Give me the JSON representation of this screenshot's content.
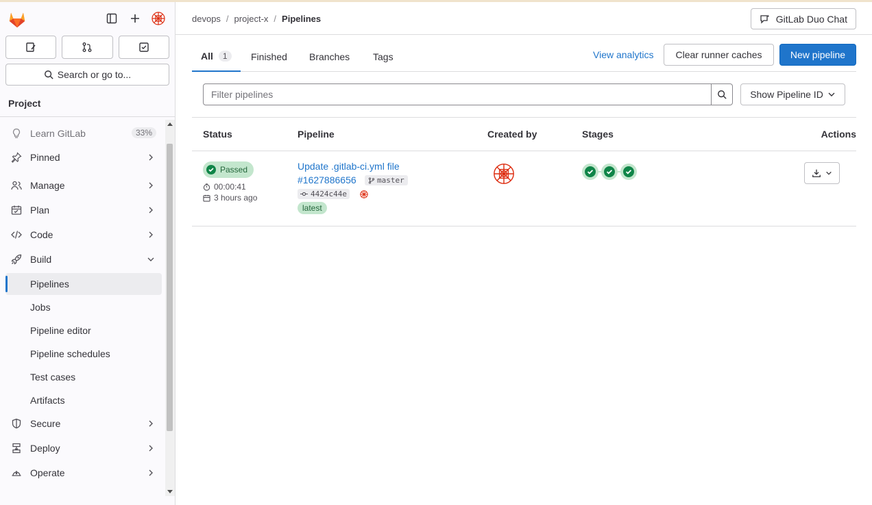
{
  "sidebar": {
    "search_label": "Search or go to...",
    "section_title": "Project",
    "learn": {
      "label": "Learn GitLab",
      "percent": "33%"
    },
    "items": [
      {
        "label": "Pinned",
        "icon": "pin-icon"
      },
      {
        "label": "Manage",
        "icon": "manage-icon"
      },
      {
        "label": "Plan",
        "icon": "plan-icon"
      },
      {
        "label": "Code",
        "icon": "code-icon"
      },
      {
        "label": "Build",
        "icon": "rocket-icon"
      }
    ],
    "build_sub": [
      "Pipelines",
      "Jobs",
      "Pipeline editor",
      "Pipeline schedules",
      "Test cases",
      "Artifacts"
    ],
    "items_after": [
      {
        "label": "Secure",
        "icon": "shield-icon"
      },
      {
        "label": "Deploy",
        "icon": "deploy-icon"
      },
      {
        "label": "Operate",
        "icon": "operate-icon"
      }
    ]
  },
  "breadcrumb": [
    "devops",
    "project-x",
    "Pipelines"
  ],
  "duo_chat_label": "GitLab Duo Chat",
  "tabs": [
    {
      "label": "All",
      "count": "1"
    },
    {
      "label": "Finished"
    },
    {
      "label": "Branches"
    },
    {
      "label": "Tags"
    }
  ],
  "view_analytics": "View analytics",
  "clear_caches": "Clear runner caches",
  "new_pipeline": "New pipeline",
  "filter_placeholder": "Filter pipelines",
  "show_pipeline_id": "Show Pipeline ID",
  "columns": [
    "Status",
    "Pipeline",
    "Created by",
    "Stages",
    "Actions"
  ],
  "pipeline": {
    "status": "Passed",
    "duration": "00:00:41",
    "time_ago": "3 hours ago",
    "title": "Update .gitlab-ci.yml file",
    "id": "#1627886656",
    "branch": "master",
    "commit": "4424c44e",
    "tag": "latest"
  },
  "colors": {
    "accent": "#1f75cb",
    "success": "#108548",
    "success_bg": "#c3e6cd"
  }
}
